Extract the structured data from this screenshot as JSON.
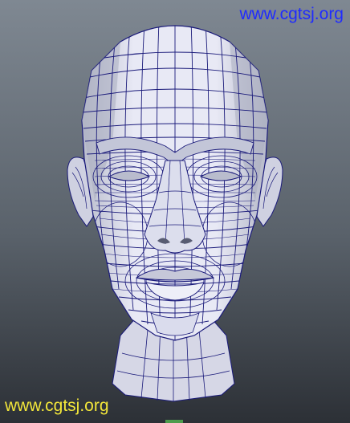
{
  "watermarks": {
    "top_right": "www.cgtsj.org",
    "bottom_left": "www.cgtsj.org"
  },
  "viewport": {
    "background_top": "#7f8892",
    "background_bottom": "#2c3036",
    "mesh_fill": "#dfe0ef",
    "mesh_wire": "#1a1a7a"
  }
}
